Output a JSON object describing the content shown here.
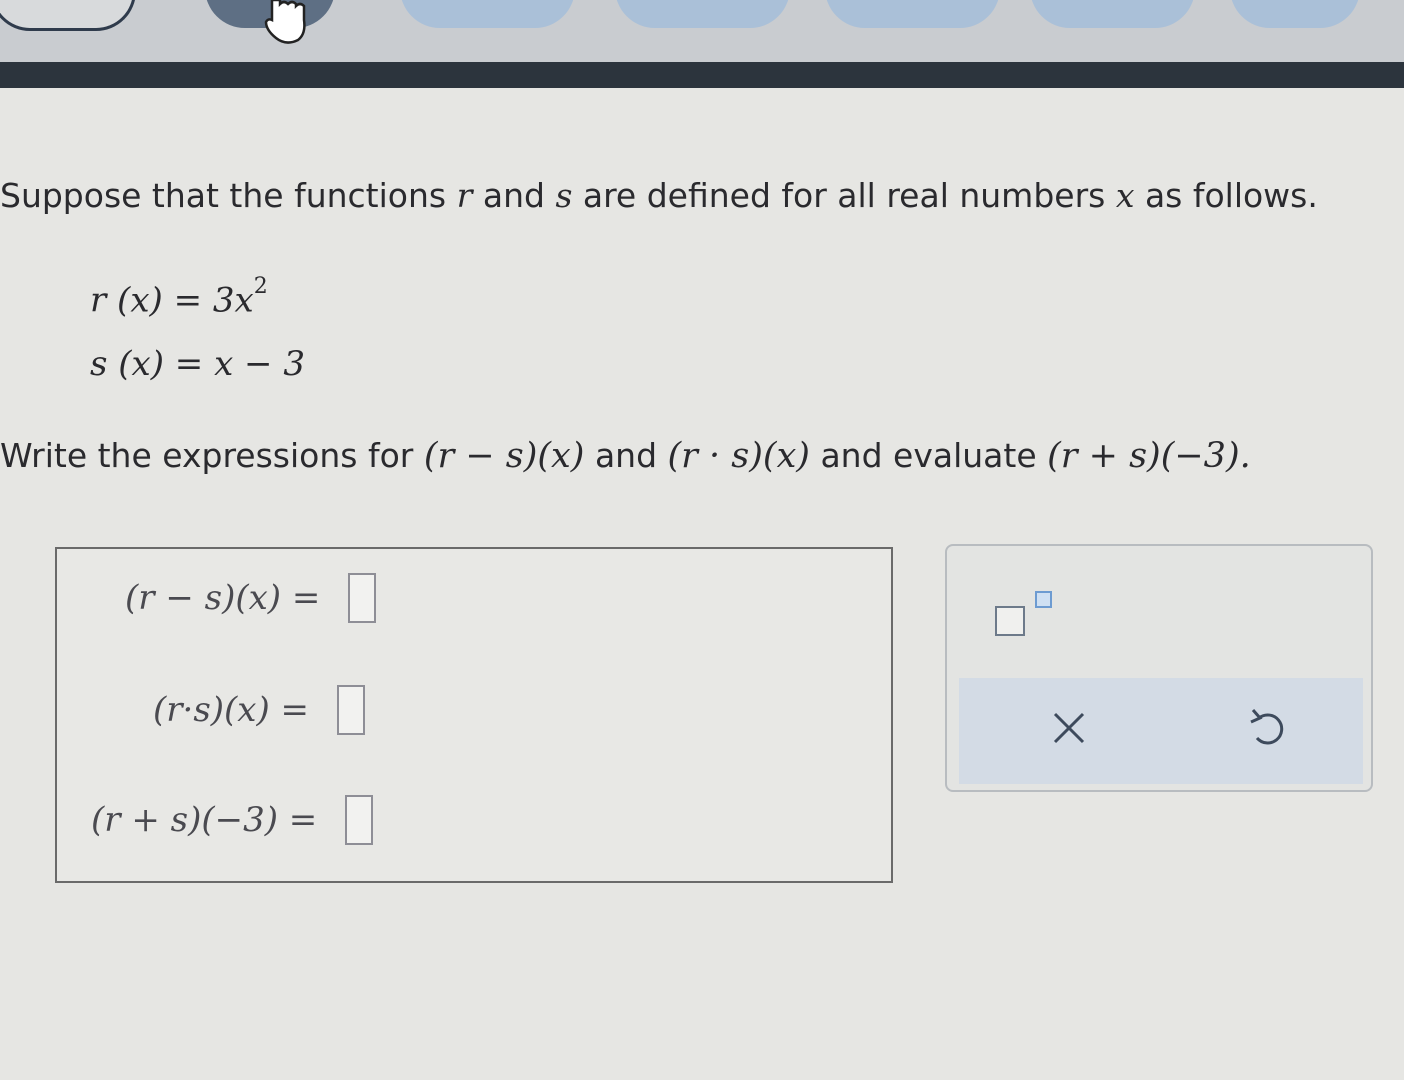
{
  "question": {
    "intro_a": "Suppose that the functions ",
    "var_r": "r",
    "and1": " and ",
    "var_s": "s",
    "intro_b": " are defined for all real numbers ",
    "var_x": "x",
    "intro_c": " as follows."
  },
  "definitions": {
    "r_lhs": "r (x) = 3x",
    "r_exp": "2",
    "s_def": "s (x) = x − 3"
  },
  "task": {
    "write": "Write the expressions for ",
    "expr1": "(r − s)(x)",
    "and_a": " and ",
    "expr2": "(r · s)(x)",
    "and_b": " and evaluate ",
    "expr3": "(r + s)(−3)."
  },
  "answers": [
    {
      "label": "(r − s)(x) =",
      "value": ""
    },
    {
      "label": "(r·s)(x) =",
      "value": ""
    },
    {
      "label": "(r + s)(−3) =",
      "value": ""
    }
  ],
  "toolbar": {
    "exponent_icon": "superscript-box-icon",
    "clear_symbol": "×",
    "undo_symbol": "↺"
  },
  "colors": {
    "accent_blue": "#6d9bd1",
    "nav_dark": "#2c343d"
  }
}
